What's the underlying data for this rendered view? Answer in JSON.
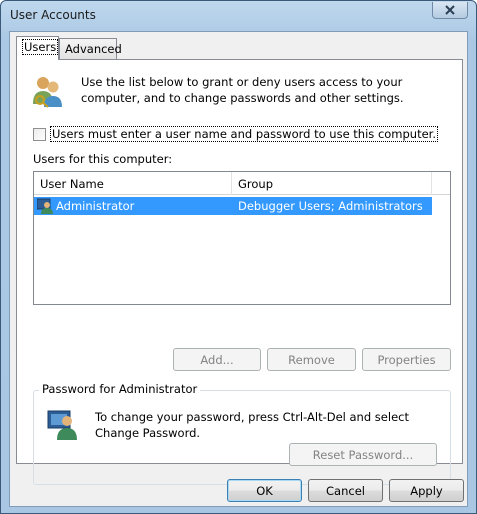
{
  "window": {
    "title": "User Accounts"
  },
  "tabs": [
    {
      "label": "Users",
      "active": true
    },
    {
      "label": "Advanced",
      "active": false
    }
  ],
  "intro": {
    "icon": "users-icon",
    "text": "Use the list below to grant or deny users access to your computer, and to change passwords and other settings."
  },
  "require_login": {
    "label": "Users must enter a user name and password to use this computer.",
    "checked": false
  },
  "users_list": {
    "label": "Users for this computer:",
    "columns": [
      "User Name",
      "Group"
    ],
    "rows": [
      {
        "name": "Administrator",
        "group": "Debugger Users; Administrators",
        "selected": true,
        "icon": "user-icon"
      }
    ]
  },
  "list_buttons": {
    "add": "Add...",
    "remove": "Remove",
    "properties": "Properties"
  },
  "password_group": {
    "legend": "Password for Administrator",
    "icon": "user-icon",
    "text": "To change your password, press Ctrl-Alt-Del and select Change Password.",
    "reset_button": "Reset Password..."
  },
  "dialog_buttons": {
    "ok": "OK",
    "cancel": "Cancel",
    "apply": "Apply"
  },
  "colors": {
    "selection": "#3399ff",
    "frame": "#aac8e4"
  }
}
